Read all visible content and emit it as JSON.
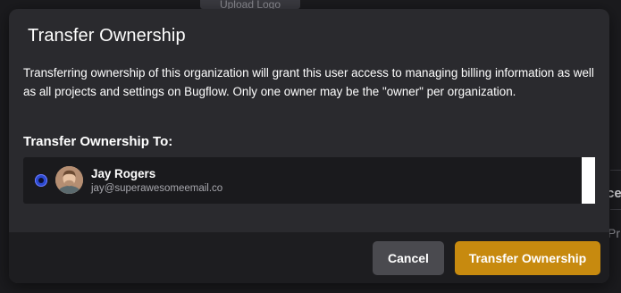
{
  "background": {
    "upload_button_label": "Upload Logo",
    "partial_heading": "ce",
    "partial_text": "Pr"
  },
  "modal": {
    "title": "Transfer Ownership",
    "description": "Transferring ownership of this organization will grant this user access to managing billing information as well as all projects and settings on Bugflow. Only one owner may be the \"owner\" per organization.",
    "section_label": "Transfer Ownership To:",
    "users": [
      {
        "name": "Jay Rogers",
        "email": "jay@superawesomeemail.co",
        "selected": true
      }
    ],
    "cancel_label": "Cancel",
    "transfer_label": "Transfer Ownership"
  },
  "colors": {
    "modal_bg": "#2a2a2e",
    "footer_bg": "#1d1d20",
    "primary_button": "#c78a0f",
    "secondary_button": "#4a4a4f",
    "radio_selected": "#2c4ad0"
  },
  "icons": {
    "avatar": "user-avatar-photo"
  }
}
